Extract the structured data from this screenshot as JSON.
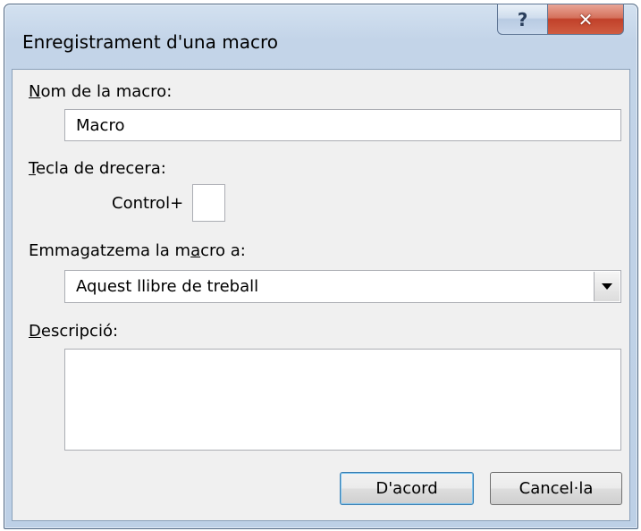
{
  "dialog": {
    "title": "Enregistrament d'una macro",
    "help_symbol": "?",
    "close_symbol": "✕"
  },
  "macro_name": {
    "label_accel": "N",
    "label_rest": "om de la macro:",
    "value": "Macro"
  },
  "shortcut": {
    "label_accel": "T",
    "label_rest": "ecla de drecera:",
    "prefix": "Control+",
    "value": ""
  },
  "store_in": {
    "label_before": "Emmagatzema la m",
    "label_accel": "a",
    "label_after": "cro a:",
    "selected": "Aquest llibre de treball"
  },
  "description": {
    "label_accel": "D",
    "label_rest": "escripció:",
    "value": ""
  },
  "buttons": {
    "ok": "D'acord",
    "cancel": "Cancel·la"
  }
}
